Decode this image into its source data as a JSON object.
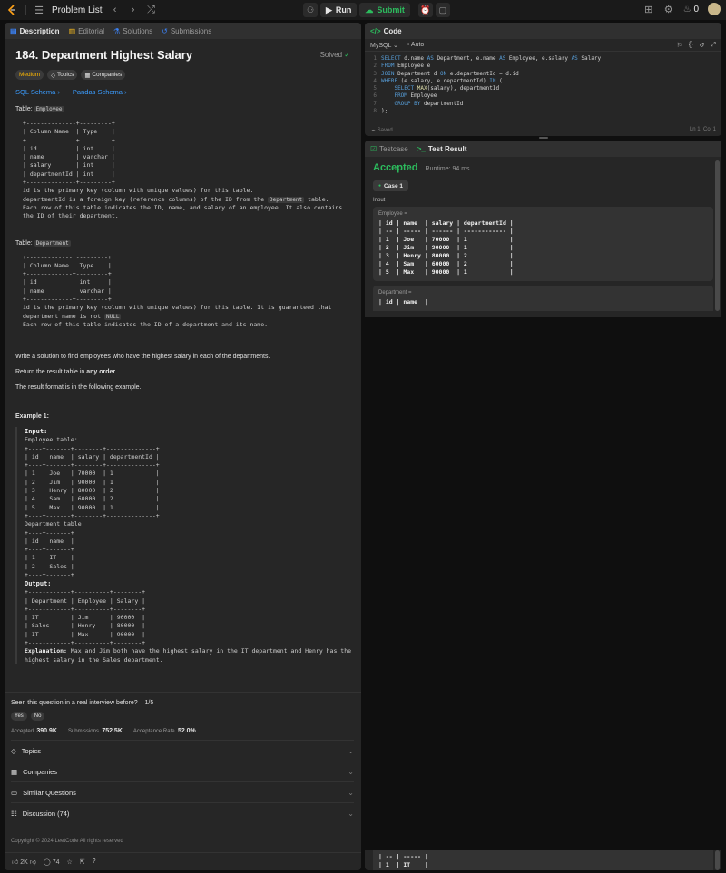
{
  "topbar": {
    "problem_list": "Problem List",
    "run": "Run",
    "submit": "Submit",
    "streak": "0"
  },
  "left_tabs": [
    {
      "label": "Description"
    },
    {
      "label": "Editorial"
    },
    {
      "label": "Solutions"
    },
    {
      "label": "Submissions"
    }
  ],
  "problem": {
    "title": "184. Department Highest Salary",
    "status": "Solved",
    "difficulty": "Medium",
    "topics_tag": "Topics",
    "companies_tag": "Companies",
    "sql_schema": "SQL Schema",
    "pandas_schema": "Pandas Schema",
    "table1_prefix": "Table: ",
    "table1_name": "Employee",
    "table1_schema": "+--------------+---------+\n| Column Name  | Type    |\n+--------------+---------+\n| id           | int     |\n| name         | varchar |\n| salary       | int     |\n| departmentId | int     |\n+--------------+---------+",
    "table1_note_1": "id is the primary key (column with unique values) for this table.",
    "table1_note_2a": "departmentId is a foreign key (reference columns) of the ID from the ",
    "table1_note_2_code": "Department",
    "table1_note_2b": " table.",
    "table1_note_3": "Each row of this table indicates the ID, name, and salary of an employee. It also contains\nthe ID of their department.",
    "table2_prefix": "Table: ",
    "table2_name": "Department",
    "table2_schema": "+-------------+---------+\n| Column Name | Type    |\n+-------------+---------+\n| id          | int     |\n| name        | varchar |\n+-------------+---------+",
    "table2_note_1": "id is the primary key (column with unique values) for this table. It is guaranteed that",
    "table2_note_2a": "department name is not ",
    "table2_note_2_code": "NULL",
    "table2_note_2b": ".",
    "table2_note_3": "Each row of this table indicates the ID of a department and its name.",
    "task": "Write a solution to find employees who have the highest salary in each of the departments.",
    "return_prefix": "Return the result table in ",
    "return_bold": "any order",
    "return_suffix": ".",
    "format": "The result format is in the following example.",
    "example_title": "Example 1:",
    "input_label": "Input:",
    "employee_table_label": "Employee table:",
    "employee_table": "+----+-------+--------+--------------+\n| id | name  | salary | departmentId |\n+----+-------+--------+--------------+\n| 1  | Joe   | 70000  | 1            |\n| 2  | Jim   | 90000  | 1            |\n| 3  | Henry | 80000  | 2            |\n| 4  | Sam   | 60000  | 2            |\n| 5  | Max   | 90000  | 1            |\n+----+-------+--------+--------------+",
    "department_table_label": "Department table:",
    "department_table": "+----+-------+\n| id | name  |\n+----+-------+\n| 1  | IT    |\n| 2  | Sales |\n+----+-------+",
    "output_label": "Output:",
    "output_table": "+------------+----------+--------+\n| Department | Employee | Salary |\n+------------+----------+--------+\n| IT         | Jim      | 90000  |\n| Sales      | Henry    | 80000  |\n| IT         | Max      | 90000  |\n+------------+----------+--------+",
    "explanation_label": "Explanation:",
    "explanation": " Max and Jim both have the highest salary in the IT department and Henry has the\nhighest salary in the Sales department."
  },
  "interview": {
    "question": "Seen this question in a real interview before?",
    "count": "1/5",
    "yes": "Yes",
    "no": "No"
  },
  "stats": {
    "accepted_label": "Accepted",
    "accepted_value": "390.9K",
    "submissions_label": "Submissions",
    "submissions_value": "752.5K",
    "rate_label": "Acceptance Rate",
    "rate_value": "52.0%"
  },
  "accordion": [
    {
      "label": "Topics"
    },
    {
      "label": "Companies"
    },
    {
      "label": "Similar Questions"
    },
    {
      "label": "Discussion (74)"
    }
  ],
  "copyright": "Copyright © 2024 LeetCode All rights reserved",
  "bottom": {
    "likes": "2K",
    "comments": "74"
  },
  "code_panel": {
    "title": "Code",
    "language": "MySQL",
    "auto": "Auto",
    "saved": "Saved",
    "cursor": "Ln 1, Col 1"
  },
  "result_panel": {
    "testcase_tab": "Testcase",
    "result_tab": "Test Result",
    "verdict": "Accepted",
    "runtime": "Runtime: 94 ms",
    "case": "Case 1",
    "input_label": "Input",
    "employee_label": "Employee =",
    "employee_table": "| id | name  | salary | departmentId |\n| -- | ----- | ------ | ------------ |\n| 1  | Joe   | 70000  | 1            |\n| 2  | Jim   | 90000  | 1            |\n| 3  | Henry | 80000  | 2            |\n| 4  | Sam   | 60000  | 2            |\n| 5  | Max   | 90000  | 1            |",
    "department_label": "Department =",
    "department_table_head": "| id | name  |",
    "department_table_tail": "| -- | ----- |\n| 1  | IT    |"
  },
  "colors": {
    "accent_green": "#2cbb5d",
    "link_blue": "#3b9dff",
    "medium_yellow": "#ffb800",
    "brand_orange": "#ffa116"
  }
}
